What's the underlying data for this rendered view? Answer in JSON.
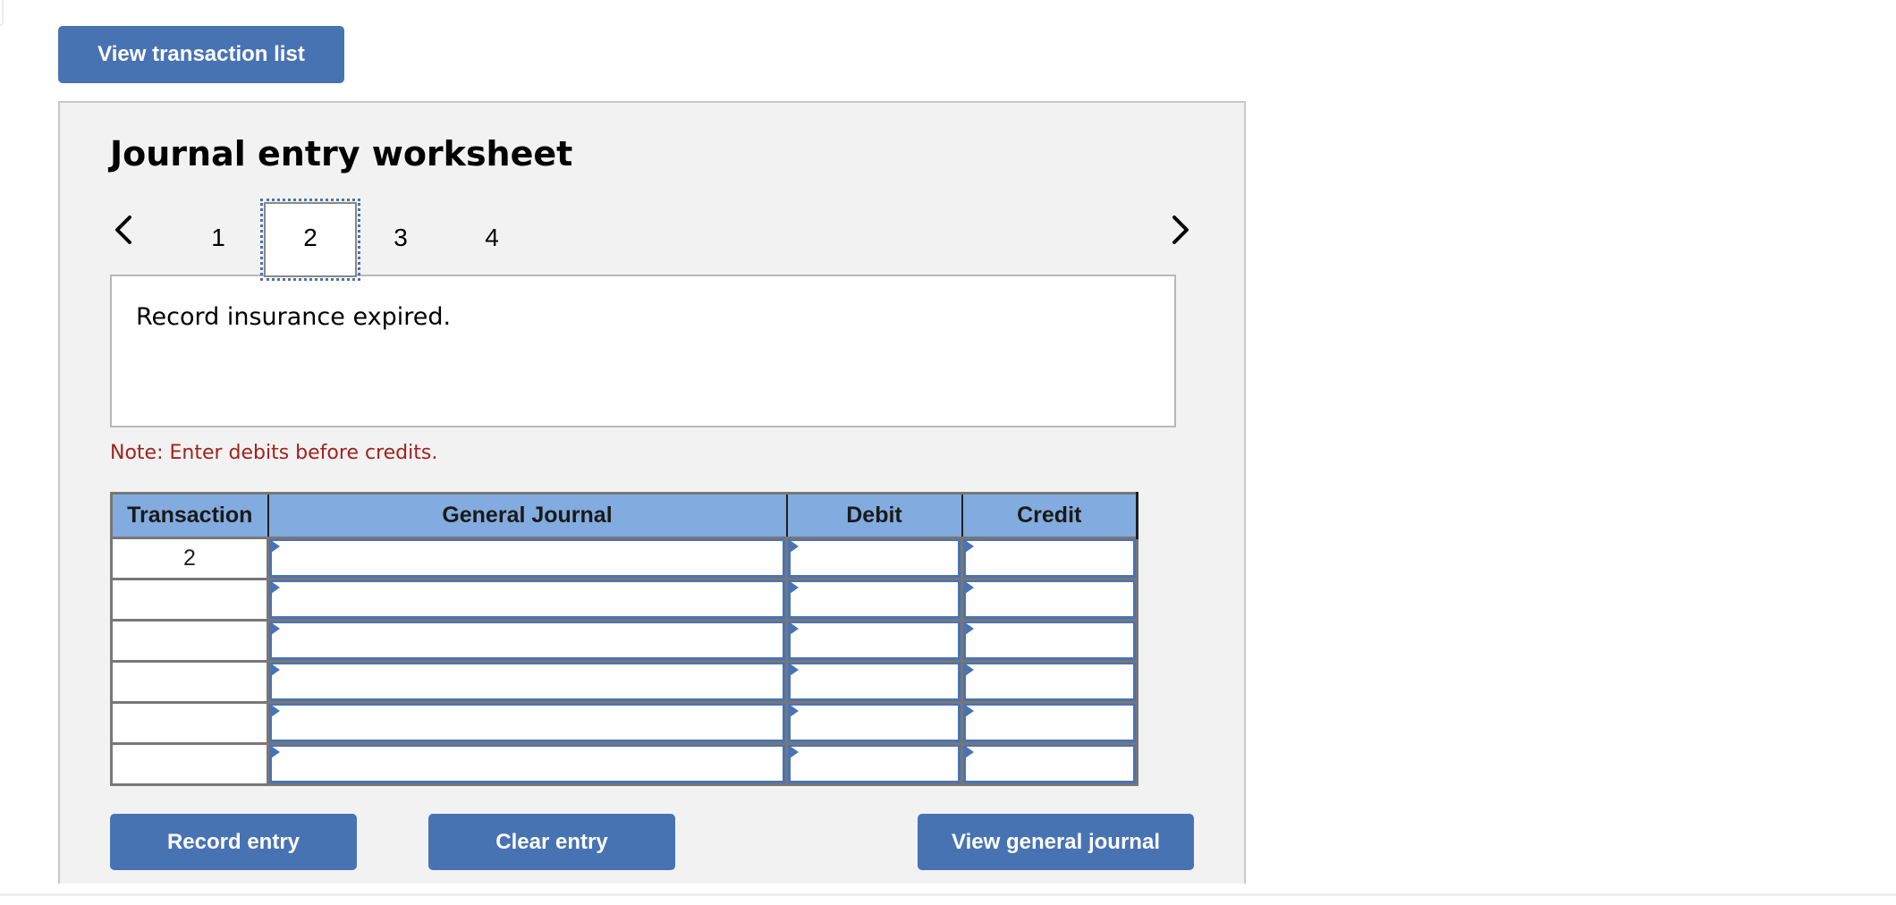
{
  "toolbar": {
    "view_transaction_list_label": "View transaction list"
  },
  "worksheet": {
    "title": "Journal entry worksheet",
    "prev_icon": "chevron-left-icon",
    "next_icon": "chevron-right-icon",
    "tabs": [
      {
        "label": "1",
        "active": false
      },
      {
        "label": "2",
        "active": true
      },
      {
        "label": "3",
        "active": false
      },
      {
        "label": "4",
        "active": false
      }
    ],
    "description": "Record insurance expired.",
    "note": "Note: Enter debits before credits.",
    "note_color": "#a0221e"
  },
  "journal_table": {
    "headers": [
      "Transaction",
      "General Journal",
      "Debit",
      "Credit"
    ],
    "header_bg": "#82abdf",
    "rows": [
      {
        "transaction": "2",
        "account": "",
        "debit": "",
        "credit": ""
      },
      {
        "transaction": "",
        "account": "",
        "debit": "",
        "credit": ""
      },
      {
        "transaction": "",
        "account": "",
        "debit": "",
        "credit": ""
      },
      {
        "transaction": "",
        "account": "",
        "debit": "",
        "credit": ""
      },
      {
        "transaction": "",
        "account": "",
        "debit": "",
        "credit": ""
      },
      {
        "transaction": "",
        "account": "",
        "debit": "",
        "credit": ""
      }
    ]
  },
  "actions": {
    "record_entry_label": "Record entry",
    "clear_entry_label": "Clear entry",
    "view_general_journal_label": "View general journal"
  },
  "colors": {
    "button_bg": "#4873b3",
    "panel_bg": "#f2f2f2",
    "cell_border": "#4a73b4"
  }
}
